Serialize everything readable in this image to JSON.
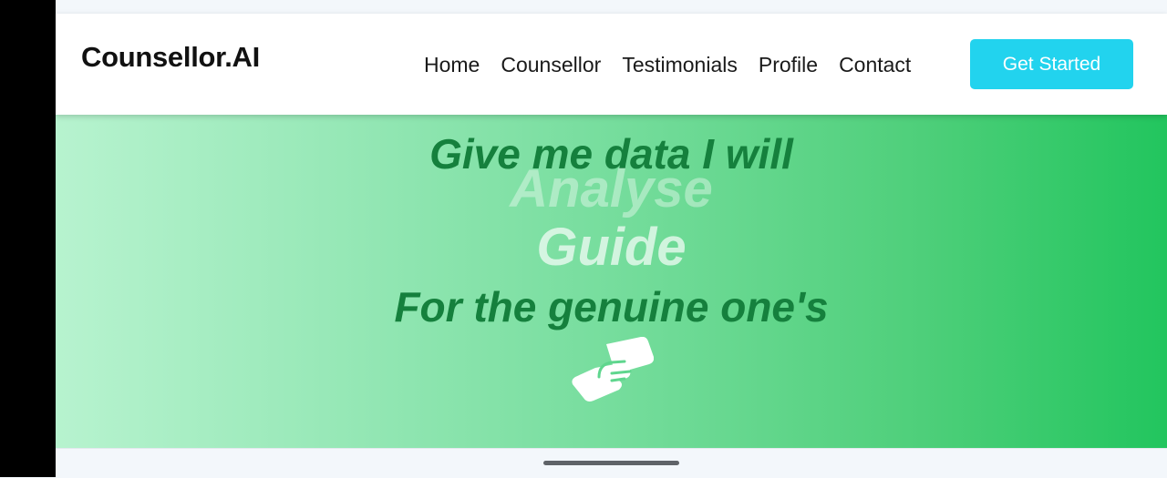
{
  "navbar": {
    "brand": "Counsellor.AI",
    "links": [
      "Home",
      "Counsellor",
      "Testimonials",
      "Profile",
      "Contact"
    ],
    "cta_label": "Get Started"
  },
  "hero": {
    "line1": "Give me data I will",
    "rotating_words": [
      "Analyse",
      "Guide"
    ],
    "line3": "For the genuine one's",
    "icon": "handshake-icon"
  },
  "colors": {
    "cta": "#22d3ee",
    "hero_text": "#15803d",
    "hero_gradient_start": "#b7f3cf",
    "hero_gradient_end": "#22c55e"
  }
}
